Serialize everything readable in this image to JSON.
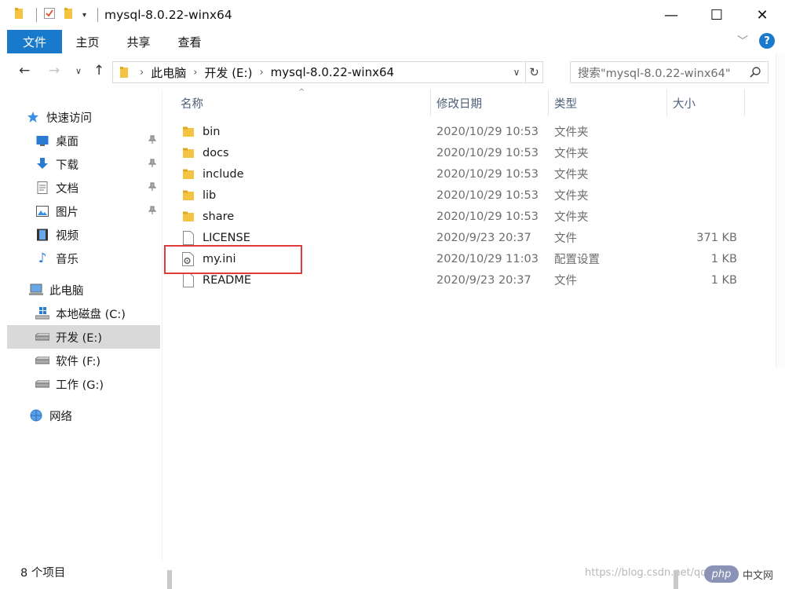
{
  "window": {
    "title": "mysql-8.0.22-winx64"
  },
  "ribbon": {
    "tabs": [
      "文件",
      "主页",
      "共享",
      "查看"
    ]
  },
  "address": {
    "segments": [
      "此电脑",
      "开发 (E:)",
      "mysql-8.0.22-winx64"
    ]
  },
  "search": {
    "placeholder": "搜索\"mysql-8.0.22-winx64\""
  },
  "sidebar": {
    "quick_access": "快速访问",
    "quick_items": [
      "桌面",
      "下载",
      "文档",
      "图片",
      "视频",
      "音乐"
    ],
    "this_pc": "此电脑",
    "drives": [
      "本地磁盘 (C:)",
      "开发 (E:)",
      "软件 (F:)",
      "工作 (G:)"
    ],
    "network": "网络",
    "selected": "开发 (E:)"
  },
  "columns": {
    "name": "名称",
    "date": "修改日期",
    "type": "类型",
    "size": "大小"
  },
  "files": [
    {
      "name": "bin",
      "date": "2020/10/29 10:53",
      "type": "文件夹",
      "size": "",
      "icon": "folder-icon"
    },
    {
      "name": "docs",
      "date": "2020/10/29 10:53",
      "type": "文件夹",
      "size": "",
      "icon": "folder-icon"
    },
    {
      "name": "include",
      "date": "2020/10/29 10:53",
      "type": "文件夹",
      "size": "",
      "icon": "folder-icon"
    },
    {
      "name": "lib",
      "date": "2020/10/29 10:53",
      "type": "文件夹",
      "size": "",
      "icon": "folder-icon"
    },
    {
      "name": "share",
      "date": "2020/10/29 10:53",
      "type": "文件夹",
      "size": "",
      "icon": "folder-icon"
    },
    {
      "name": "LICENSE",
      "date": "2020/9/23 20:37",
      "type": "文件",
      "size": "371 KB",
      "icon": "file-icon"
    },
    {
      "name": "my.ini",
      "date": "2020/10/29 11:03",
      "type": "配置设置",
      "size": "1 KB",
      "icon": "config-file-icon"
    },
    {
      "name": "README",
      "date": "2020/9/23 20:37",
      "type": "文件",
      "size": "1 KB",
      "icon": "file-icon"
    }
  ],
  "status": {
    "item_count": "8 个项目"
  },
  "watermark": {
    "text": "https://blog.csdn.net/qq_",
    "badge": "php",
    "badge_suffix": "中文网"
  },
  "colors": {
    "accent": "#1979ca",
    "selected_bg": "#d9d9d9",
    "highlight_box": "#e03b3b",
    "folder": "#f5c342"
  }
}
